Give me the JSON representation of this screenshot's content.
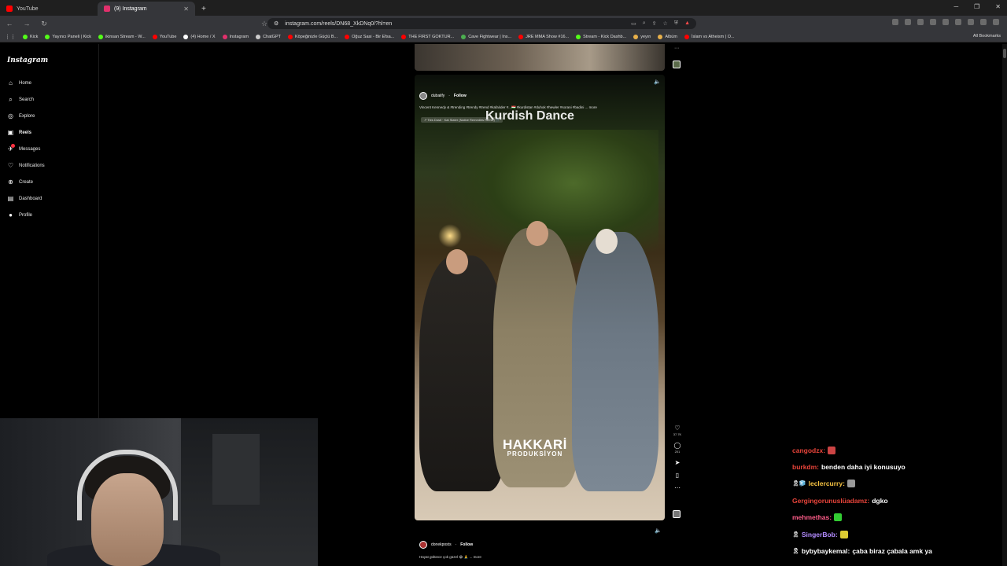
{
  "browser": {
    "tabs": [
      {
        "label": "YouTube",
        "color": "#ff0000",
        "active": false
      },
      {
        "label": "(9) Instagram",
        "color": "#e1306c",
        "active": true
      }
    ],
    "url": "instagram.com/reels/DN68_XkDNq0/?hl=en",
    "bookmarks": [
      {
        "label": "Kick",
        "color": "#53fc18"
      },
      {
        "label": "Yayıncı Paneli | Kick",
        "color": "#53fc18"
      },
      {
        "label": "ikinsan Stream - W...",
        "color": "#53fc18"
      },
      {
        "label": "YouTube",
        "color": "#ff0000"
      },
      {
        "label": "(4) Home / X",
        "color": "#ffffff"
      },
      {
        "label": "Instagram",
        "color": "#e1306c"
      },
      {
        "label": "ChatGPT",
        "color": "#cccccc"
      },
      {
        "label": "Köpeğinizle Güçlü B...",
        "color": "#ff0000"
      },
      {
        "label": "Oğuz Sasi - Bir Efsa...",
        "color": "#ff0000"
      },
      {
        "label": "THE FIRST GOKTUR...",
        "color": "#ff0000"
      },
      {
        "label": "Cave Fightwear | Ins...",
        "color": "#4caf50"
      },
      {
        "label": "JRE MMA Show #16...",
        "color": "#ff0000"
      },
      {
        "label": "Stream - Kick Dashb...",
        "color": "#53fc18"
      },
      {
        "label": "yeyın",
        "color": "#e8b04a"
      },
      {
        "label": "Albüm",
        "color": "#e8b04a"
      },
      {
        "label": "İslam vs Atheism | O...",
        "color": "#ff0000"
      }
    ],
    "all_bookmarks": "All Bookmarks"
  },
  "sidebar": {
    "logo": "Instagram",
    "items": [
      {
        "label": "Home",
        "icon": "⌂",
        "name": "home-icon"
      },
      {
        "label": "Search",
        "icon": "⌕",
        "name": "search-icon"
      },
      {
        "label": "Explore",
        "icon": "◎",
        "name": "explore-icon"
      },
      {
        "label": "Reels",
        "icon": "▣",
        "name": "reels-icon"
      },
      {
        "label": "Messages",
        "icon": "✈",
        "name": "messages-icon"
      },
      {
        "label": "Notifications",
        "icon": "♡",
        "name": "heart-icon"
      },
      {
        "label": "Create",
        "icon": "⊕",
        "name": "create-icon"
      },
      {
        "label": "Dashboard",
        "icon": "▤",
        "name": "dashboard-icon"
      },
      {
        "label": "Profile",
        "icon": "●",
        "name": "profile-icon"
      }
    ]
  },
  "reel": {
    "username": "dubaiify",
    "follow": "Follow",
    "caption": "Vincent Kennedy & #trending #trendy #trend #kafalıder #...🇹🇯 #kurdistan #duhok #hewler #sorani #badini ... more",
    "audio": "↗ Ties Dusit · Kat Slater (Native Remedies Remix) 🎵",
    "overlay_title": "Kurdish Dance",
    "watermark_line1": "HAKKARİ",
    "watermark_line2": "PRODUKSİYON",
    "likes": "37.7K",
    "comments": "201"
  },
  "next_reel": {
    "username": "donekposts",
    "follow": "Follow",
    "caption": "Hayat gülünce çok güzel 😂 🙏 ... more"
  },
  "chat": [
    {
      "user": "cangodzx:",
      "text": "",
      "color": "#e8443a",
      "emote": "#c44",
      "badge": ""
    },
    {
      "user": "burkdm:",
      "text": "benden daha iyi konusuyo",
      "color": "#e8443a",
      "emote": "",
      "badge": ""
    },
    {
      "user": "leclercurry:",
      "text": "",
      "color": "#f5c242",
      "emote": "#999",
      "badge": "🎗🧊"
    },
    {
      "user": "Gergingorunuslüadamz:",
      "text": "dgko",
      "color": "#e8443a",
      "emote": "",
      "badge": ""
    },
    {
      "user": "mehmethas:",
      "text": "",
      "color": "#ff5d8a",
      "emote": "#3c3",
      "badge": ""
    },
    {
      "user": "SingerBob:",
      "text": "",
      "color": "#b38cff",
      "emote": "#dc3",
      "badge": "🎗"
    },
    {
      "user": "bybybaykemal:",
      "text": "çaba biraz çabala amk ya",
      "color": "#ffffff",
      "emote": "",
      "badge": "🎗"
    }
  ]
}
